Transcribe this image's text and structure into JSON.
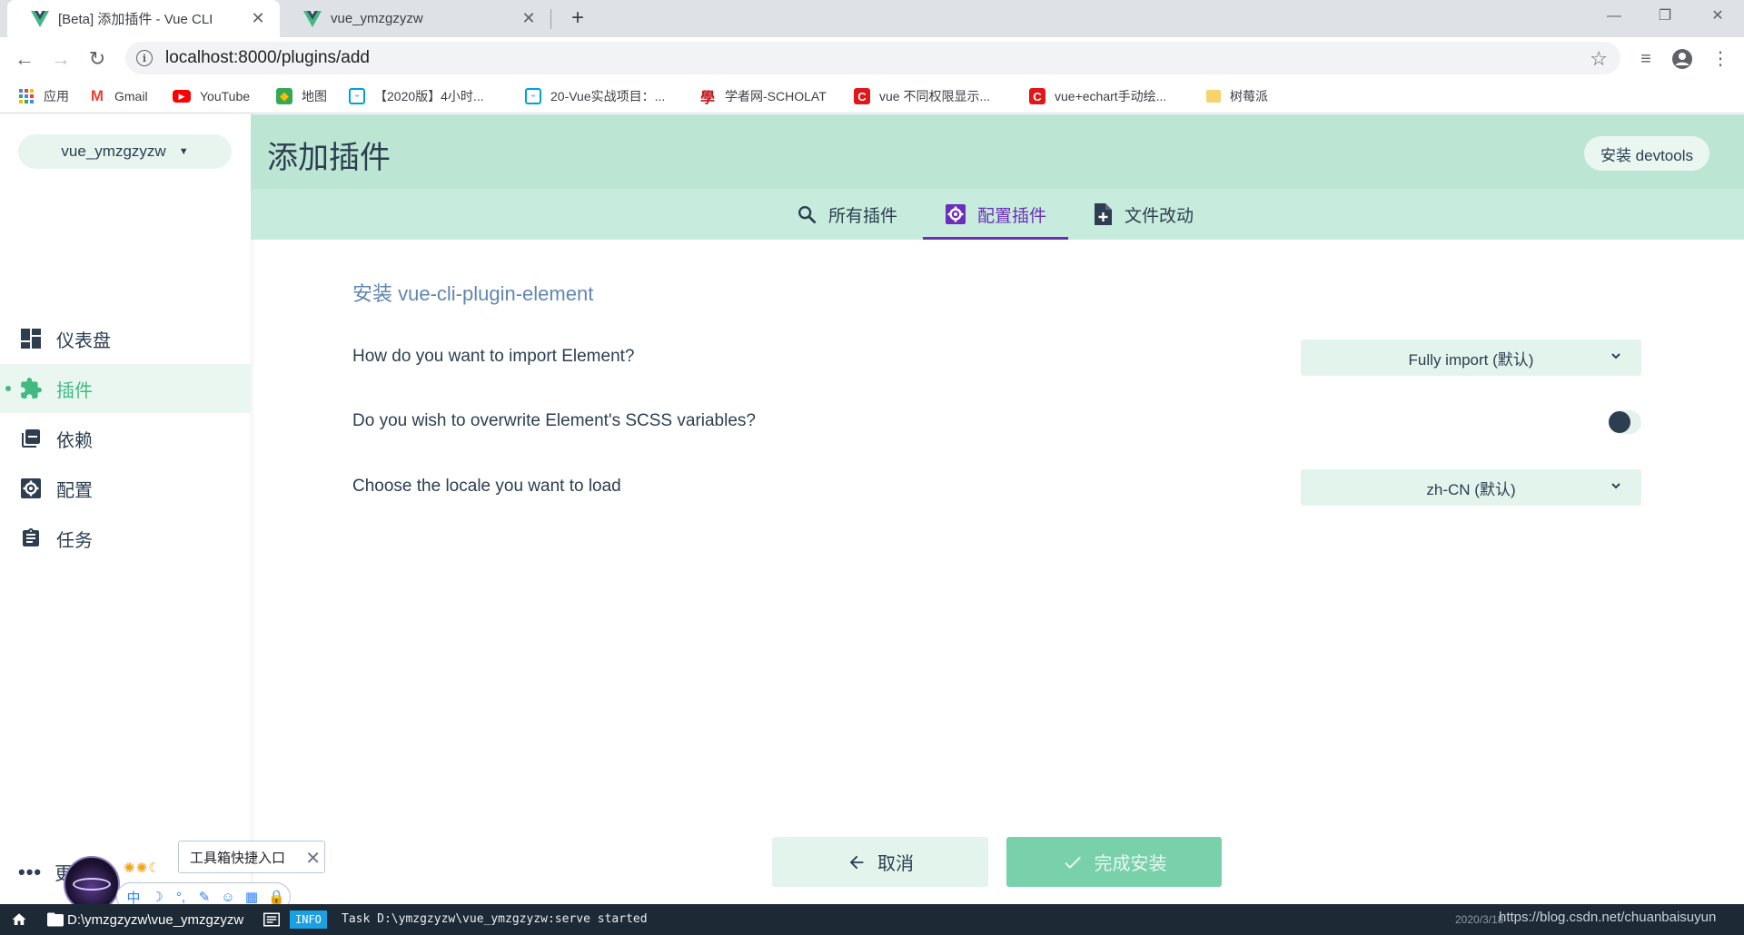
{
  "browser": {
    "tabs": [
      {
        "title": "[Beta] 添加插件 - Vue CLI",
        "active": true
      },
      {
        "title": "vue_ymzgzyzw",
        "active": false
      }
    ],
    "address": "localhost:8000/plugins/add",
    "bookmarks": [
      {
        "label": "应用",
        "icon": "apps-grid-icon"
      },
      {
        "label": "Gmail",
        "icon": "gmail-icon"
      },
      {
        "label": "YouTube",
        "icon": "youtube-icon"
      },
      {
        "label": "地图",
        "icon": "maps-icon"
      },
      {
        "label": "【2020版】4小时...",
        "icon": "bilibili-icon"
      },
      {
        "label": "20-Vue实战项目：...",
        "icon": "bilibili-icon"
      },
      {
        "label": "学者网-SCHOLAT",
        "icon": "scholat-icon"
      },
      {
        "label": "vue 不同权限显示...",
        "icon": "csdn-icon"
      },
      {
        "label": "vue+echart手动绘...",
        "icon": "csdn-icon"
      },
      {
        "label": "树莓派",
        "icon": "folder-icon"
      }
    ]
  },
  "sidebar": {
    "project": "vue_ymzgzyzw",
    "items": [
      {
        "label": "仪表盘",
        "icon": "dashboard-icon",
        "active": false
      },
      {
        "label": "插件",
        "icon": "puzzle-icon",
        "active": true
      },
      {
        "label": "依赖",
        "icon": "library-icon",
        "active": false
      },
      {
        "label": "配置",
        "icon": "settings-icon",
        "active": false
      },
      {
        "label": "任务",
        "icon": "clipboard-icon",
        "active": false
      }
    ],
    "more_label": "更"
  },
  "header": {
    "title": "添加插件",
    "devtools_label": "安装 devtools"
  },
  "tabs": [
    {
      "label": "所有插件",
      "icon": "search-icon",
      "active": false
    },
    {
      "label": "配置插件",
      "icon": "gear-box-icon",
      "active": true
    },
    {
      "label": "文件改动",
      "icon": "file-plus-icon",
      "active": false
    }
  ],
  "content": {
    "install_title": "安装 vue-cli-plugin-element",
    "prompts": [
      {
        "label": "How do you want to import Element?",
        "type": "select",
        "value": "Fully import (默认)"
      },
      {
        "label": "Do you wish to overwrite Element's SCSS variables?",
        "type": "toggle",
        "value": false
      },
      {
        "label": "Choose the locale you want to load",
        "type": "select",
        "value": "zh-CN (默认)"
      }
    ],
    "cancel_label": "取消",
    "finish_label": "完成安装"
  },
  "overlay": {
    "tooltip": "工具箱快捷入口",
    "toolbox_glyphs": [
      "中",
      "☽",
      "°,",
      "✎",
      "☺",
      "▦",
      "🔒"
    ]
  },
  "statusbar": {
    "path": "D:\\ymzgzyzw\\vue_ymzgzyzw",
    "badge": "INFO",
    "message": "Task D:\\ymzgzyzw\\vue_ymzgzyzw:serve started",
    "time": "2020/3/18"
  },
  "watermark": "https://blog.csdn.net/chuanbaisuyun",
  "colors": {
    "accent_green": "#42b983",
    "header_bg": "#bde5d4",
    "active_tab": "#6b2fb9",
    "statusbar_bg": "#1d2935"
  }
}
